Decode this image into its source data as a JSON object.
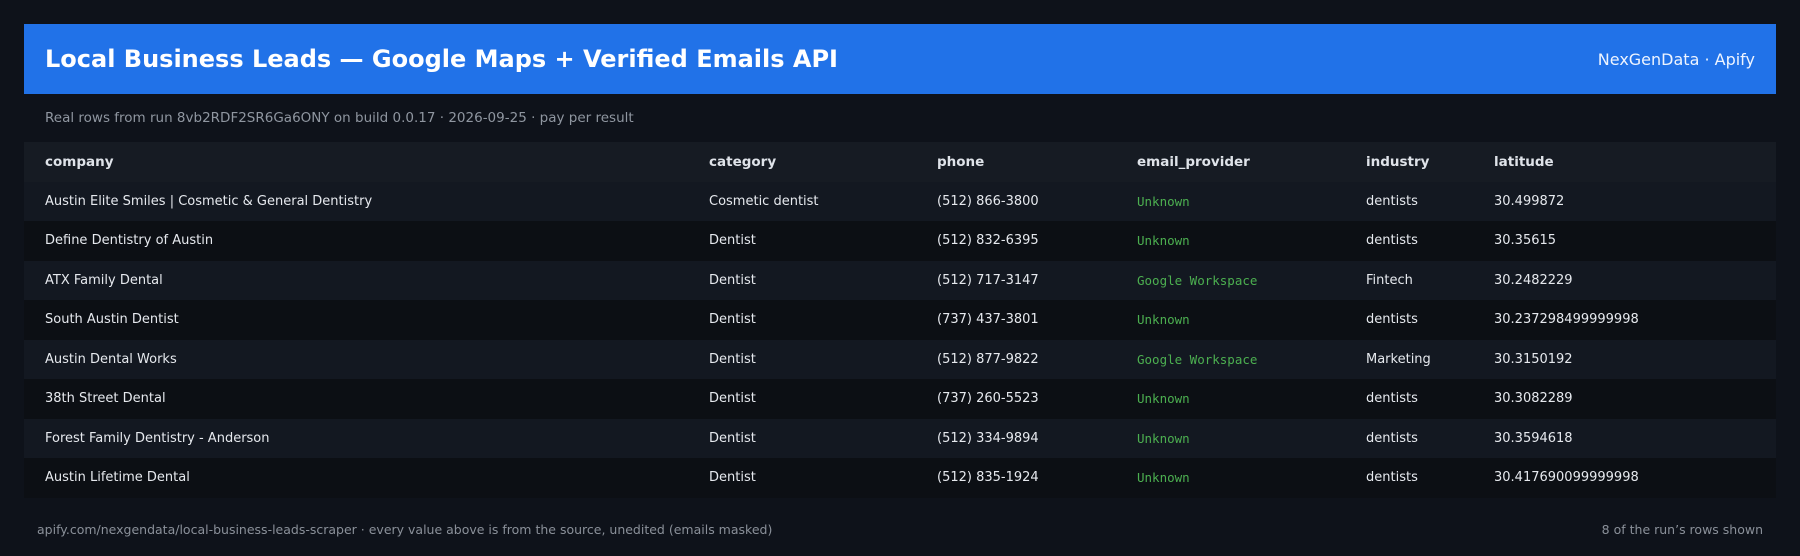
{
  "header": {
    "title": "Local Business Leads — Google Maps + Verified Emails API",
    "brand": "NexGenData · Apify"
  },
  "subtitle": "Real rows from run 8vb2RDF2SR6Ga6ONY on build 0.0.17 · 2026-09-25 · pay per result",
  "table": {
    "columns": [
      "company",
      "category",
      "phone",
      "email_provider",
      "industry",
      "latitude"
    ],
    "rows": [
      {
        "company": "Austin Elite Smiles | Cosmetic & General Dentistry",
        "category": "Cosmetic dentist",
        "phone": "(512) 866-3800",
        "email_provider": "Unknown",
        "industry": "dentists",
        "latitude": "30.499872"
      },
      {
        "company": "Define Dentistry of Austin",
        "category": "Dentist",
        "phone": "(512) 832-6395",
        "email_provider": "Unknown",
        "industry": "dentists",
        "latitude": "30.35615"
      },
      {
        "company": "ATX Family Dental",
        "category": "Dentist",
        "phone": "(512) 717-3147",
        "email_provider": "Google Workspace",
        "industry": "Fintech",
        "latitude": "30.2482229"
      },
      {
        "company": "South Austin Dentist",
        "category": "Dentist",
        "phone": "(737) 437-3801",
        "email_provider": "Unknown",
        "industry": "dentists",
        "latitude": "30.237298499999998"
      },
      {
        "company": "Austin Dental Works",
        "category": "Dentist",
        "phone": "(512) 877-9822",
        "email_provider": "Google Workspace",
        "industry": "Marketing",
        "latitude": "30.3150192"
      },
      {
        "company": "38th Street Dental",
        "category": "Dentist",
        "phone": "(737) 260-5523",
        "email_provider": "Unknown",
        "industry": "dentists",
        "latitude": "30.3082289"
      },
      {
        "company": "Forest Family Dentistry - Anderson",
        "category": "Dentist",
        "phone": "(512) 334-9894",
        "email_provider": "Unknown",
        "industry": "dentists",
        "latitude": "30.3594618"
      },
      {
        "company": "Austin Lifetime Dental",
        "category": "Dentist",
        "phone": "(512) 835-1924",
        "email_provider": "Unknown",
        "industry": "dentists",
        "latitude": "30.417690099999998"
      }
    ]
  },
  "footer": {
    "source": "apify.com/nexgendata/local-business-leads-scraper  ·  every value above is from the source, unedited (emails masked)",
    "count": "8 of the run’s rows shown"
  },
  "colors": {
    "header_bg": "#2172e8",
    "page_bg": "#0e121a",
    "email_provider_text": "#4caf50"
  }
}
